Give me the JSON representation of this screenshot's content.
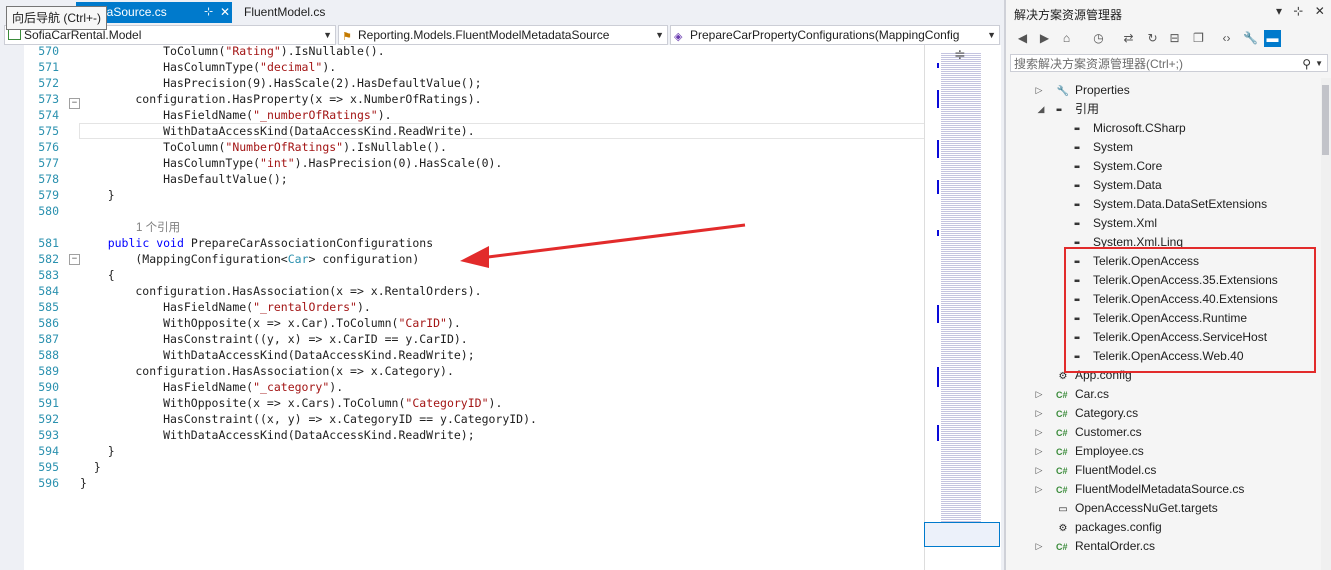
{
  "tooltip": "向后导航 (Ctrl+-)",
  "tabs": {
    "active": "dataSource.cs",
    "pin": "⊹",
    "close": "✕",
    "second": "FluentModel.cs"
  },
  "navbar": {
    "project": "SofiaCarRental.Model",
    "class": "Reporting.Models.FluentModelMetadataSource",
    "member": "PrepareCarPropertyConfigurations(MappingConfig"
  },
  "code_lines": [
    {
      "n": "570",
      "code": [
        [
          "t",
          "            "
        ],
        [
          "t",
          "ToColumn("
        ],
        [
          "s",
          "\"Rating\""
        ],
        [
          "t",
          ").IsNullable()."
        ]
      ]
    },
    {
      "n": "571",
      "code": [
        [
          "t",
          "            HasColumnType("
        ],
        [
          "s",
          "\"decimal\""
        ],
        [
          "t",
          ")."
        ]
      ]
    },
    {
      "n": "572",
      "code": [
        [
          "t",
          "            HasPrecision(9).HasScale(2).HasDefaultValue();"
        ]
      ]
    },
    {
      "n": "573",
      "code": [
        [
          "t",
          "        configuration.HasProperty(x => x.NumberOfRatings)."
        ]
      ]
    },
    {
      "n": "574",
      "code": [
        [
          "t",
          "            HasFieldName("
        ],
        [
          "s",
          "\"_numberOfRatings\""
        ],
        [
          "t",
          ")."
        ]
      ]
    },
    {
      "n": "575",
      "code": [
        [
          "t",
          "            WithDataAccessKind(DataAccessKind.ReadWrite)."
        ]
      ]
    },
    {
      "n": "576",
      "code": [
        [
          "t",
          "            ToColumn("
        ],
        [
          "s",
          "\"NumberOfRatings\""
        ],
        [
          "t",
          ").IsNullable()."
        ]
      ]
    },
    {
      "n": "577",
      "code": [
        [
          "t",
          "            HasColumnType("
        ],
        [
          "s",
          "\"int\""
        ],
        [
          "t",
          ").HasPrecision(0).HasScale(0)."
        ]
      ]
    },
    {
      "n": "578",
      "code": [
        [
          "t",
          "            HasDefaultValue();"
        ]
      ]
    },
    {
      "n": "579",
      "code": [
        [
          "t",
          "    }"
        ]
      ]
    },
    {
      "n": "580",
      "code": [
        [
          "t",
          ""
        ]
      ]
    },
    {
      "n": "",
      "code": [
        [
          "c",
          "1 个引用"
        ]
      ]
    },
    {
      "n": "581",
      "code": [
        [
          "t",
          "    "
        ],
        [
          "k",
          "public"
        ],
        [
          "t",
          " "
        ],
        [
          "k",
          "void"
        ],
        [
          "t",
          " PrepareCarAssociationConfigurations"
        ]
      ]
    },
    {
      "n": "582",
      "code": [
        [
          "t",
          "        (MappingConfiguration<"
        ],
        [
          "y",
          "Car"
        ],
        [
          "t",
          "> configuration)"
        ]
      ]
    },
    {
      "n": "583",
      "code": [
        [
          "t",
          "    {"
        ]
      ]
    },
    {
      "n": "584",
      "code": [
        [
          "t",
          "        configuration.HasAssociation(x => x.RentalOrders)."
        ]
      ]
    },
    {
      "n": "585",
      "code": [
        [
          "t",
          "            HasFieldName("
        ],
        [
          "s",
          "\"_rentalOrders\""
        ],
        [
          "t",
          ")."
        ]
      ]
    },
    {
      "n": "586",
      "code": [
        [
          "t",
          "            WithOpposite(x => x.Car).ToColumn("
        ],
        [
          "s",
          "\"CarID\""
        ],
        [
          "t",
          ")."
        ]
      ]
    },
    {
      "n": "587",
      "code": [
        [
          "t",
          "            HasConstraint((y, x) => x.CarID == y.CarID)."
        ]
      ]
    },
    {
      "n": "588",
      "code": [
        [
          "t",
          "            WithDataAccessKind(DataAccessKind.ReadWrite);"
        ]
      ]
    },
    {
      "n": "589",
      "code": [
        [
          "t",
          "        configuration.HasAssociation(x => x.Category)."
        ]
      ]
    },
    {
      "n": "590",
      "code": [
        [
          "t",
          "            HasFieldName("
        ],
        [
          "s",
          "\"_category\""
        ],
        [
          "t",
          ")."
        ]
      ]
    },
    {
      "n": "591",
      "code": [
        [
          "t",
          "            WithOpposite(x => x.Cars).ToColumn("
        ],
        [
          "s",
          "\"CategoryID\""
        ],
        [
          "t",
          ")."
        ]
      ]
    },
    {
      "n": "592",
      "code": [
        [
          "t",
          "            HasConstraint((x, y) => x.CategoryID == y.CategoryID)."
        ]
      ]
    },
    {
      "n": "593",
      "code": [
        [
          "t",
          "            WithDataAccessKind(DataAccessKind.ReadWrite);"
        ]
      ]
    },
    {
      "n": "594",
      "code": [
        [
          "t",
          "    }"
        ]
      ]
    },
    {
      "n": "595",
      "code": [
        [
          "t",
          "  }"
        ]
      ]
    },
    {
      "n": "596",
      "code": [
        [
          "t",
          "}"
        ]
      ]
    }
  ],
  "solution_explorer": {
    "title": "解决方案资源管理器",
    "search_placeholder": "搜索解决方案资源管理器(Ctrl+;)",
    "tree": [
      {
        "label": "Properties",
        "kind": "props",
        "expander": "▷"
      },
      {
        "label": "引用",
        "kind": "refs",
        "expander": "◢"
      },
      {
        "label": "Microsoft.CSharp",
        "kind": "ref"
      },
      {
        "label": "System",
        "kind": "ref"
      },
      {
        "label": "System.Core",
        "kind": "ref"
      },
      {
        "label": "System.Data",
        "kind": "ref"
      },
      {
        "label": "System.Data.DataSetExtensions",
        "kind": "ref"
      },
      {
        "label": "System.Xml",
        "kind": "ref"
      },
      {
        "label": "System.Xml.Linq",
        "kind": "ref"
      },
      {
        "label": "Telerik.OpenAccess",
        "kind": "ref"
      },
      {
        "label": "Telerik.OpenAccess.35.Extensions",
        "kind": "ref"
      },
      {
        "label": "Telerik.OpenAccess.40.Extensions",
        "kind": "ref"
      },
      {
        "label": "Telerik.OpenAccess.Runtime",
        "kind": "ref"
      },
      {
        "label": "Telerik.OpenAccess.ServiceHost",
        "kind": "ref"
      },
      {
        "label": "Telerik.OpenAccess.Web.40",
        "kind": "ref"
      },
      {
        "label": "App.config",
        "kind": "config"
      },
      {
        "label": "Car.cs",
        "kind": "cs",
        "expander": "▷"
      },
      {
        "label": "Category.cs",
        "kind": "cs",
        "expander": "▷"
      },
      {
        "label": "Customer.cs",
        "kind": "cs",
        "expander": "▷"
      },
      {
        "label": "Employee.cs",
        "kind": "cs",
        "expander": "▷"
      },
      {
        "label": "FluentModel.cs",
        "kind": "cs",
        "expander": "▷"
      },
      {
        "label": "FluentModelMetadataSource.cs",
        "kind": "cs",
        "expander": "▷"
      },
      {
        "label": "OpenAccessNuGet.targets",
        "kind": "file"
      },
      {
        "label": "packages.config",
        "kind": "config"
      },
      {
        "label": "RentalOrder.cs",
        "kind": "cs",
        "expander": "▷"
      }
    ]
  },
  "icons": {
    "pin": "pin-icon",
    "close": "close-icon",
    "search": "search-icon"
  },
  "colors": {
    "accent": "#007acc",
    "highlight": "#e22b2b",
    "keyword": "#0000ff",
    "string": "#a31515",
    "type": "#2b91af"
  }
}
